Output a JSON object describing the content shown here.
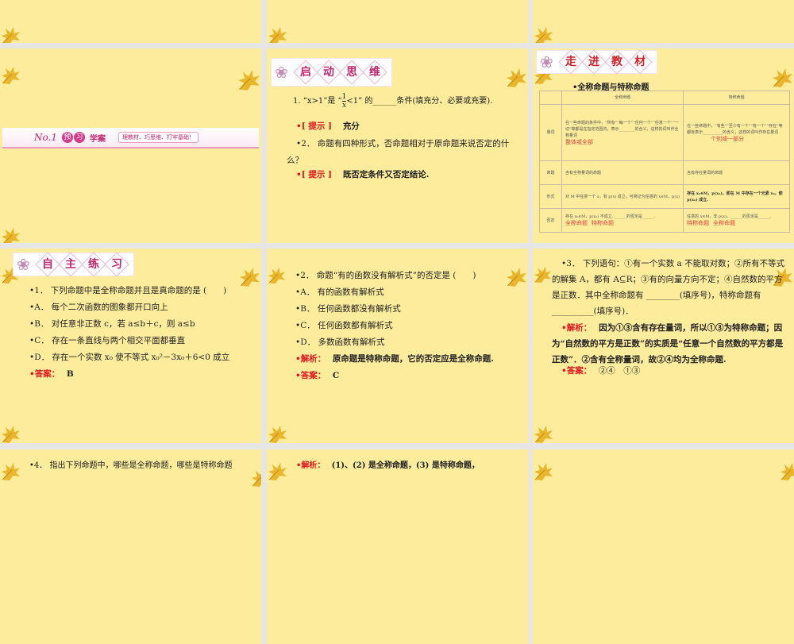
{
  "slide2": {
    "no": "No.1",
    "badge1": "预",
    "badge2": "习",
    "title": "学案",
    "tagline": "理教材、巧思维、打牢基础！"
  },
  "slide3": {
    "banner": [
      "启",
      "动",
      "思",
      "维"
    ],
    "q1_pre": "1. “x>1”是 “",
    "q1_frac_num": "1",
    "q1_frac_den": "x",
    "q1_post": "<1” 的______条件(填充分、必要或充要).",
    "hint_label": "•[ 提示 ]",
    "hint1": "充分",
    "q2": "•2． 命题有四种形式，否命题相对于原命题来说否定的什么？",
    "hint2": "既否定条件又否定结论."
  },
  "slide4": {
    "banner": [
      "走",
      "进",
      "教",
      "材"
    ],
    "heading": "•全称命题与特称命题",
    "col1": "全称命题",
    "col2": "特称命题",
    "rows": [
      {
        "label": "量词",
        "c1": "在一些命题的条件中，“所有”“每一个”“任何一个”“任意一个”“一切”等都是在指定范围内，表示________的含义，这样的词叫作全称量词",
        "f1": "整体或全部",
        "c2": "在一些命题中，“有些”“至少有一个”“有一个”“存在”等都有表示__________的含义，这样的词叫作存在量词",
        "f2": "个别或一部分"
      },
      {
        "label": "命题",
        "c1": "含有全称量词的命题",
        "c2": "含有存在量词的命题"
      },
      {
        "label": "形式",
        "c1": "对 M 中任意一个 x，有 p(x) 成立，可简记为任意的 x∈M，p(x)",
        "c2": "存在 x₀∈M，p(x₀)，即在 M 中存在一个元素 x₀，使 p(x₀) 成立."
      },
      {
        "label": "否定",
        "c1": "存在 x₀∈M，p(x₀) 不成立. ______的否定是______.",
        "f1a": "全称命题",
        "f1b": "特称命题",
        "c2": "任意的 x∈M，非 p(x)，______的否定是______.",
        "f2a": "特称命题",
        "f2b": "全称命题"
      }
    ]
  },
  "slide5": {
    "banner": [
      "自",
      "主",
      "练",
      "习"
    ],
    "lines": [
      "•1． 下列命题中是全称命题并且是真命题的是 (　　)",
      "•A． 每个二次函数的图象都开口向上",
      "•B． 对任意非正数 c，若 a≤b＋c，则 a≤b",
      "•C． 存在一条直线与两个相交平面都垂直",
      "•D． 存在一个实数 x₀ 使不等式 x₀²－3x₀＋6<0 成立"
    ],
    "answer_label": "•答案：",
    "answer": "B"
  },
  "slide6": {
    "lines": [
      "•2． 命题“有的函数没有解析式”的否定是 (　　)",
      "•A． 有的函数有解析式",
      "•B． 任何函数都没有解析式",
      "•C． 任何函数都有解析式",
      "•D． 多数函数有解析式"
    ],
    "analysis_label": "•解析：",
    "analysis": "原命题是特称命题，它的否定应是全称命题.",
    "answer_label": "•答案：",
    "answer": "C"
  },
  "slide7": {
    "question": "•3． 下列语句：①有一个实数 a 不能取对数；②所有不等式的解集 A，都有 A⊆R；③有的向量方向不定；④自然数的平方是正数．其中全称命题有 ________(填序号)，特称命题有 __________(填序号)．",
    "analysis_label": "•解析：",
    "analysis": "因为①③含有存在量词，所以①③为特称命题；因为“自然数的平方是正数”的实质是“任意一个自然数的平方都是正数”．②含有全称量词，故②④均为全称命题.",
    "answer_label": "•答案：",
    "answer": "②④　①③"
  },
  "slide8": {
    "text": "•4． 指出下列命题中，哪些是全称命题，哪些是特称命题"
  },
  "slide9": {
    "analysis_label": "•解析：",
    "analysis": "(1)、(2) 是全称命题，(3) 是特称命题，"
  },
  "colors": {
    "slide_bg": "#fcec9c",
    "accent_red": "#e3161d",
    "banner_pink": "#c0286e"
  }
}
